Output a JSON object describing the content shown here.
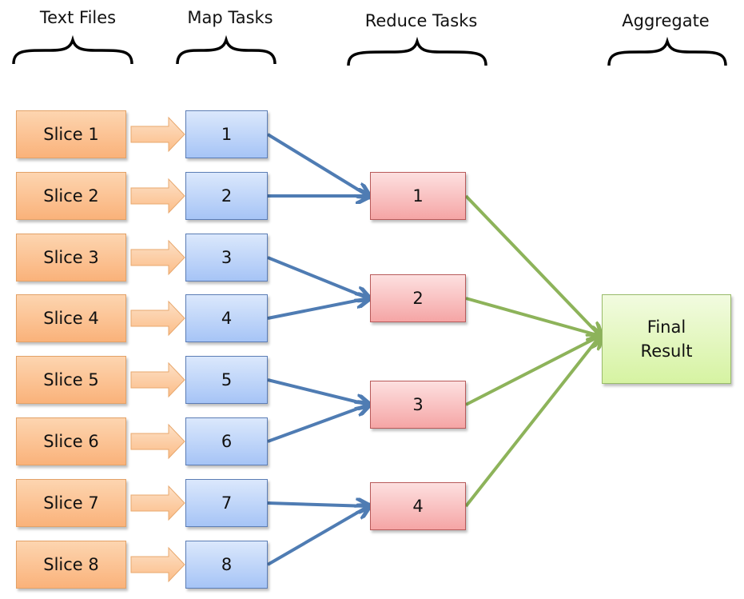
{
  "headers": {
    "text_files": "Text Files",
    "map_tasks": "Map Tasks",
    "reduce_tasks": "Reduce Tasks",
    "aggregate": "Aggregate"
  },
  "slices": [
    "Slice 1",
    "Slice 2",
    "Slice 3",
    "Slice 4",
    "Slice 5",
    "Slice 6",
    "Slice 7",
    "Slice 8"
  ],
  "map_tasks": [
    "1",
    "2",
    "3",
    "4",
    "5",
    "6",
    "7",
    "8"
  ],
  "reduce_tasks": [
    "1",
    "2",
    "3",
    "4"
  ],
  "final": {
    "line1": "Final",
    "line2": "Result"
  },
  "edges": {
    "slice_to_map": [
      [
        1,
        1
      ],
      [
        2,
        2
      ],
      [
        3,
        3
      ],
      [
        4,
        4
      ],
      [
        5,
        5
      ],
      [
        6,
        6
      ],
      [
        7,
        7
      ],
      [
        8,
        8
      ]
    ],
    "map_to_reduce": [
      [
        1,
        1
      ],
      [
        2,
        1
      ],
      [
        3,
        2
      ],
      [
        4,
        2
      ],
      [
        5,
        3
      ],
      [
        6,
        3
      ],
      [
        7,
        4
      ],
      [
        8,
        4
      ]
    ],
    "reduce_to_final": [
      1,
      2,
      3,
      4
    ]
  },
  "colors": {
    "slice": "#fab27a",
    "map": "#a6c4f6",
    "reduce": "#f5a5a5",
    "final": "#d6f3a2",
    "map_arrow": "#4f7cb3",
    "aggregate_arrow": "#8db35a",
    "block_arrow": "#fbc99b"
  }
}
